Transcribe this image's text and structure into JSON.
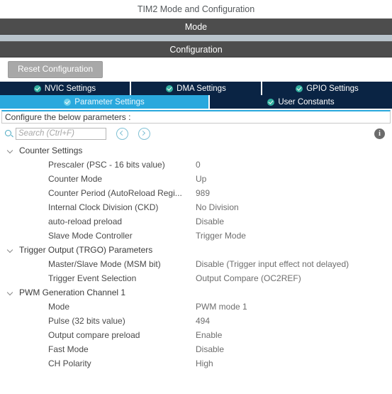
{
  "header": {
    "title": "TIM2 Mode and Configuration",
    "mode_bar": "Mode",
    "configuration_bar": "Configuration"
  },
  "toolbar": {
    "reset_label": "Reset Configuration"
  },
  "tabs_row1": [
    {
      "label": "NVIC Settings",
      "icon": "check-circle-icon",
      "active": false
    },
    {
      "label": "DMA Settings",
      "icon": "check-circle-icon",
      "active": false
    },
    {
      "label": "GPIO Settings",
      "icon": "check-circle-icon",
      "active": false
    }
  ],
  "tabs_row2": [
    {
      "label": "Parameter Settings",
      "icon": "check-circle-icon",
      "active": true
    },
    {
      "label": "User Constants",
      "icon": "check-circle-icon",
      "active": false
    }
  ],
  "configure_strip": {
    "text": "Configure the below parameters :"
  },
  "search": {
    "placeholder": "Search (Ctrl+F)",
    "value": "",
    "icon": "search-icon",
    "prev_icon": "chevron-left-circle-icon",
    "next_icon": "chevron-right-circle-icon",
    "info_icon": "info-icon",
    "info_glyph": "i"
  },
  "groups": [
    {
      "title": "Counter Settings",
      "params": [
        {
          "label": "Prescaler (PSC - 16 bits value)",
          "value": "0"
        },
        {
          "label": "Counter Mode",
          "value": "Up"
        },
        {
          "label": "Counter Period (AutoReload Regi...",
          "value": "989"
        },
        {
          "label": "Internal Clock Division (CKD)",
          "value": "No Division"
        },
        {
          "label": "auto-reload preload",
          "value": "Disable"
        },
        {
          "label": "Slave Mode Controller",
          "value": "Trigger Mode"
        }
      ]
    },
    {
      "title": "Trigger Output (TRGO) Parameters",
      "params": [
        {
          "label": "Master/Slave Mode (MSM bit)",
          "value": "Disable (Trigger input effect not delayed)"
        },
        {
          "label": "Trigger Event Selection",
          "value": "Output Compare (OC2REF)"
        }
      ]
    },
    {
      "title": "PWM Generation Channel 1",
      "params": [
        {
          "label": "Mode",
          "value": "PWM mode 1"
        },
        {
          "label": "Pulse (32 bits value)",
          "value": "494"
        },
        {
          "label": "Output compare preload",
          "value": "Enable"
        },
        {
          "label": "Fast Mode",
          "value": "Disable"
        },
        {
          "label": "CH Polarity",
          "value": "High"
        }
      ]
    }
  ],
  "colors": {
    "tab_inactive": "#0a2444",
    "tab_active": "#29a8dd",
    "section_bar": "#4d4d4d",
    "band": "#b9c4cc",
    "check": "#32b0a0",
    "accent": "#49a8c0"
  }
}
